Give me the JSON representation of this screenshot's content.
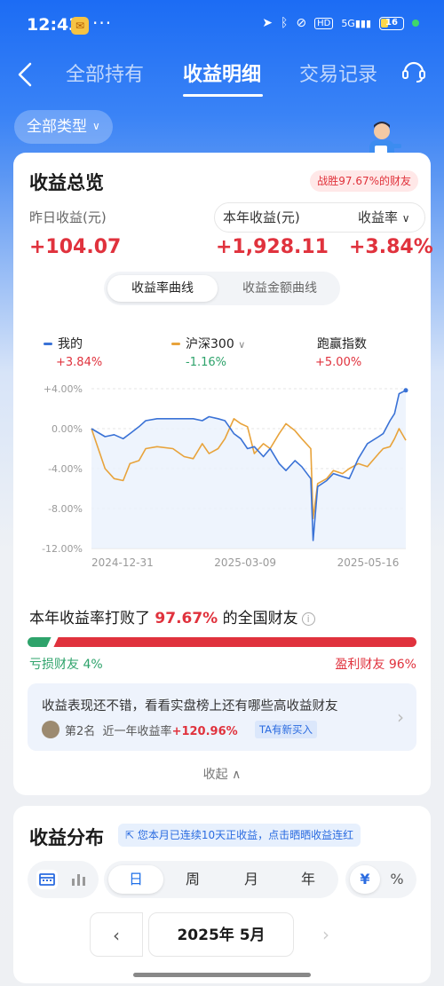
{
  "status_bar": {
    "time": "12:43",
    "battery": "16"
  },
  "nav": {
    "tabs": [
      "全部持有",
      "收益明细",
      "交易记录"
    ],
    "active_tab": "收益明细"
  },
  "filter": {
    "type_label": "全部类型"
  },
  "overview": {
    "title": "收益总览",
    "beat_badge": "战胜97.67%的财友",
    "yesterday_label": "昨日收益(元)",
    "yesterday_value": "+104.07",
    "year_label": "本年收益(元)",
    "year_value": "+1,928.11",
    "rate_label": "收益率",
    "rate_value": "+3.84%",
    "curve_tabs": [
      "收益率曲线",
      "收益金额曲线"
    ],
    "legend": [
      {
        "name": "我的",
        "value": "+3.84%",
        "color": "#3a72d6",
        "value_color": "#e0323d"
      },
      {
        "name": "沪深300",
        "value": "-1.16%",
        "color": "#e8a33b",
        "value_color": "#2ea36b"
      },
      {
        "name": "跑赢指数",
        "value": "+5.00%",
        "value_color": "#e0323d"
      }
    ]
  },
  "chart_data": {
    "type": "line",
    "x_ticks": [
      "2024-12-31",
      "2025-03-09",
      "2025-05-16"
    ],
    "y_ticks": [
      "+4.00%",
      "0.00%",
      "-4.00%",
      "-8.00%",
      "-12.00%"
    ],
    "ylim": [
      -12,
      4
    ],
    "x": [
      "2024-12-31",
      "2025-01-06",
      "2025-01-10",
      "2025-01-14",
      "2025-01-17",
      "2025-01-21",
      "2025-01-24",
      "2025-01-29",
      "2025-02-05",
      "2025-02-10",
      "2025-02-14",
      "2025-02-18",
      "2025-02-21",
      "2025-02-25",
      "2025-02-28",
      "2025-03-04",
      "2025-03-07",
      "2025-03-10",
      "2025-03-13",
      "2025-03-17",
      "2025-03-20",
      "2025-03-24",
      "2025-03-27",
      "2025-03-31",
      "2025-04-03",
      "2025-04-07",
      "2025-04-08",
      "2025-04-10",
      "2025-04-14",
      "2025-04-17",
      "2025-04-21",
      "2025-04-24",
      "2025-04-28",
      "2025-05-02",
      "2025-05-07",
      "2025-05-09",
      "2025-05-12",
      "2025-05-14",
      "2025-05-16",
      "2025-05-19"
    ],
    "series": [
      {
        "name": "我的",
        "color": "#3a72d6",
        "values": [
          0.0,
          -0.8,
          -0.6,
          -1.0,
          -0.5,
          0.2,
          0.8,
          1.0,
          1.0,
          1.0,
          1.0,
          0.8,
          1.2,
          1.0,
          0.8,
          -0.5,
          -1.0,
          -2.0,
          -1.8,
          -2.8,
          -2.0,
          -3.5,
          -4.2,
          -3.2,
          -3.8,
          -5.0,
          -11.2,
          -5.8,
          -5.2,
          -4.5,
          -4.8,
          -5.0,
          -3.0,
          -1.5,
          -0.8,
          -0.5,
          0.8,
          1.5,
          3.5,
          3.84
        ]
      },
      {
        "name": "沪深300",
        "color": "#e8a33b",
        "values": [
          0.0,
          -4.0,
          -5.0,
          -5.2,
          -3.5,
          -3.2,
          -2.0,
          -1.8,
          -2.0,
          -2.8,
          -3.0,
          -1.5,
          -2.5,
          -2.0,
          -1.0,
          1.0,
          0.5,
          0.2,
          -2.5,
          -1.5,
          -2.0,
          -0.5,
          0.5,
          -0.2,
          -1.0,
          -2.0,
          -9.0,
          -5.5,
          -5.0,
          -4.2,
          -4.5,
          -4.0,
          -3.5,
          -3.8,
          -2.5,
          -2.0,
          -1.8,
          -1.0,
          0.0,
          -1.16
        ]
      }
    ]
  },
  "beat": {
    "prefix": "本年收益率打败了",
    "percent": "97.67%",
    "suffix": "的全国财友",
    "loss_label": "亏损财友 4%",
    "win_label": "盈利财友 96%",
    "loss_fraction": 0.04,
    "win_fraction": 0.96
  },
  "promo": {
    "text": "收益表现还不错，看看实盘榜上还有哪些高收益财友",
    "rank": "第2名",
    "rank_desc": "近一年收益率",
    "rank_value": "+120.96%",
    "tag": "TA有新买入"
  },
  "collapse_label": "收起",
  "distribution": {
    "title": "收益分布",
    "streak_tag": "您本月已连续10天正收益，点击晒晒收益连红",
    "periods": [
      "日",
      "周",
      "月",
      "年"
    ],
    "active_period": "日",
    "units": [
      "¥",
      "%"
    ],
    "month_label": "2025年 5月"
  }
}
